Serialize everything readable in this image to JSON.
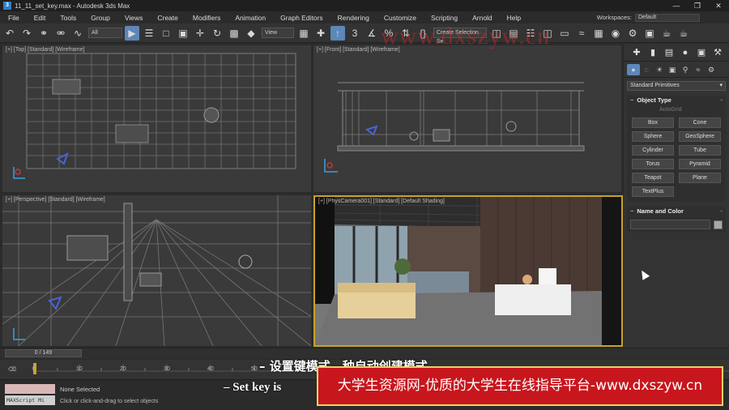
{
  "window": {
    "title": "11_11_set_key.max - Autodesk 3ds Max",
    "controls": [
      "—",
      "❐",
      "✕"
    ]
  },
  "menu": [
    "File",
    "Edit",
    "Tools",
    "Group",
    "Views",
    "Create",
    "Modifiers",
    "Animation",
    "Graph Editors",
    "Rendering",
    "Customize",
    "Scripting",
    "Arnold",
    "Help"
  ],
  "workspace": {
    "label": "Workspaces:",
    "value": "Default"
  },
  "toolbar": {
    "filter": "All",
    "view": "View",
    "selection_set": "Create Selection Se"
  },
  "viewports": {
    "top": "[+] [Top] [Standard] [Wireframe]",
    "front": "[+] [Front] [Standard] [Wireframe]",
    "perspective": "[+] [Perspective] [Standard] [Wireframe]",
    "camera": "[+] [PhysCamera001] [Standard] [Default Shading]"
  },
  "command_panel": {
    "dropdown": "Standard Primitives",
    "object_type_title": "Object Type",
    "autogrid": "AutoGrid",
    "objects": [
      "Box",
      "Cone",
      "Sphere",
      "GeoSphere",
      "Cylinder",
      "Tube",
      "Torus",
      "Pyramid",
      "Teapot",
      "Plane",
      "TextPlus"
    ],
    "name_color_title": "Name and Color"
  },
  "timeline": {
    "slider": "0 / 149",
    "ticks": [
      "0",
      "10",
      "20",
      "30",
      "40",
      "50"
    ]
  },
  "status": {
    "maxscript": "MAXScript Mi",
    "selection": "None Selected",
    "hint": "Click or click-and-drag to select objects"
  },
  "subtitle": {
    "cn": "– 设置键模式—种自动创建模式",
    "en": "– Set key is"
  },
  "banner": "大学生资源网-优质的大学生在线指导平台-www.dxszyw.cn",
  "watermark": "www.dxszyw.cn"
}
